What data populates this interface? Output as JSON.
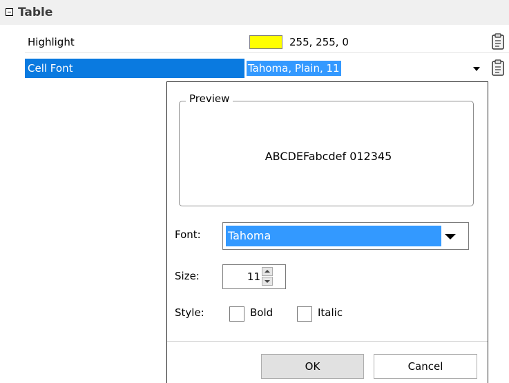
{
  "property_grid": {
    "group": {
      "label": "Table"
    },
    "rows": [
      {
        "name": "Highlight",
        "value": "255, 255, 0",
        "swatch_color": "#ffff00",
        "icon": "clipboard-icon"
      },
      {
        "name": "Cell Font",
        "value": "Tahoma, Plain, 11",
        "selected": true,
        "icon": "clipboard-icon"
      }
    ]
  },
  "font_popup": {
    "preview_label": "Preview",
    "preview_text": "ABCDEFabcdef 012345",
    "font_label": "Font:",
    "font_value": "Tahoma",
    "size_label": "Size:",
    "size_value": "11",
    "style_label": "Style:",
    "bold_label": "Bold",
    "bold_checked": false,
    "italic_label": "Italic",
    "italic_checked": false,
    "ok_label": "OK",
    "cancel_label": "Cancel"
  },
  "colors": {
    "selection": "#0a7ae0",
    "text_highlight": "#3399ff",
    "swatch": "#ffff00"
  }
}
